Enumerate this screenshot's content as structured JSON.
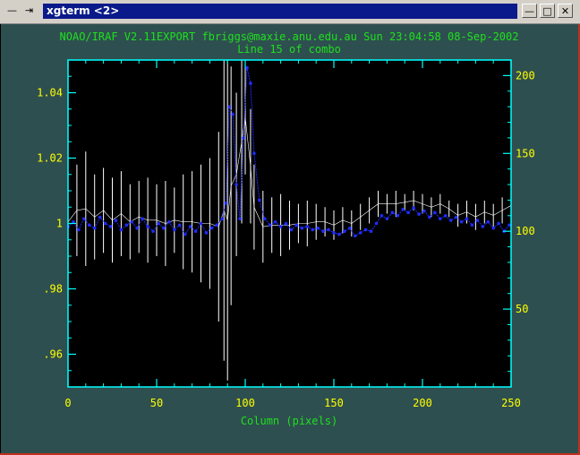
{
  "window": {
    "title": "xgterm <2>",
    "menu_glyph": "—",
    "pin_glyph": "⇥",
    "minimize_glyph": "—",
    "maximize_glyph": "□",
    "close_glyph": "✕"
  },
  "header": {
    "line1": "NOAO/IRAF V2.11EXPORT fbriggs@maxie.anu.edu.au Sun 23:04:58 08-Sep-2002",
    "line2": "Line 15 of combo"
  },
  "chart_data": {
    "type": "line",
    "title": "Line 15 of combo",
    "xlabel": "Column (pixels)",
    "ylabel": "",
    "xlim": [
      0,
      250
    ],
    "ylim": [
      0.95,
      1.05
    ],
    "y2lim": [
      0,
      210
    ],
    "xticks": [
      "0",
      "50",
      "100",
      "150",
      "200",
      "250"
    ],
    "yticks": [
      {
        "value": 0.96,
        "label": ".96"
      },
      {
        "value": 0.98,
        "label": ".98"
      },
      {
        "value": 1.0,
        "label": "1"
      },
      {
        "value": 1.02,
        "label": "1.02"
      },
      {
        "value": 1.04,
        "label": "1.04"
      }
    ],
    "y2ticks": [
      {
        "value": 50,
        "label": "50"
      },
      {
        "value": 100,
        "label": "100"
      },
      {
        "value": 150,
        "label": "150"
      },
      {
        "value": 200,
        "label": "200"
      }
    ],
    "colors": {
      "axes": "#00ffff",
      "ticklabels": "#ffff00",
      "text": "#1ee01e",
      "series_white": "#ffffff",
      "series_blue": "#1e2cff"
    },
    "series": [
      {
        "color": "#ffffff",
        "style": "vertical-lines",
        "x": [
          0,
          5,
          10,
          15,
          20,
          25,
          30,
          35,
          40,
          45,
          50,
          55,
          60,
          65,
          70,
          75,
          80,
          85,
          88,
          90,
          92,
          95,
          98,
          100,
          103,
          105,
          110,
          115,
          120,
          125,
          130,
          135,
          140,
          145,
          150,
          155,
          160,
          165,
          170,
          175,
          180,
          185,
          190,
          195,
          200,
          205,
          210,
          215,
          220,
          225,
          230,
          235,
          240,
          245,
          250
        ],
        "ymin": [
          0.988,
          0.99,
          0.987,
          0.989,
          0.991,
          0.988,
          0.99,
          0.989,
          0.991,
          0.988,
          0.99,
          0.987,
          0.991,
          0.986,
          0.985,
          0.982,
          0.98,
          0.97,
          0.958,
          0.952,
          0.975,
          0.99,
          1.0,
          1.015,
          1.0,
          0.992,
          0.988,
          0.991,
          0.99,
          0.992,
          0.994,
          0.993,
          0.995,
          0.996,
          0.995,
          0.997,
          0.996,
          0.998,
          1.0,
          1.002,
          1.003,
          1.002,
          1.004,
          1.004,
          1.003,
          1.002,
          1.003,
          1.002,
          0.999,
          1.0,
          0.998,
          1.0,
          0.999,
          1.0,
          1.001
        ],
        "ymax": [
          1.013,
          1.018,
          1.022,
          1.015,
          1.017,
          1.014,
          1.016,
          1.012,
          1.013,
          1.014,
          1.012,
          1.013,
          1.011,
          1.015,
          1.016,
          1.018,
          1.02,
          1.028,
          1.05,
          1.05,
          1.048,
          1.04,
          1.05,
          1.05,
          1.035,
          1.018,
          1.01,
          1.008,
          1.009,
          1.007,
          1.006,
          1.007,
          1.006,
          1.005,
          1.004,
          1.005,
          1.004,
          1.006,
          1.008,
          1.01,
          1.009,
          1.01,
          1.009,
          1.01,
          1.009,
          1.008,
          1.009,
          1.007,
          1.006,
          1.007,
          1.006,
          1.007,
          1.006,
          1.008,
          1.01
        ]
      },
      {
        "color": "#1e2cff",
        "style": "points",
        "x": [
          0,
          3,
          6,
          9,
          12,
          15,
          18,
          21,
          24,
          27,
          30,
          33,
          36,
          39,
          42,
          45,
          48,
          51,
          54,
          57,
          60,
          63,
          66,
          69,
          72,
          75,
          78,
          81,
          84,
          87,
          89,
          91,
          93,
          95,
          97,
          99,
          101,
          103,
          105,
          108,
          111,
          114,
          117,
          120,
          123,
          126,
          129,
          132,
          135,
          138,
          141,
          144,
          147,
          150,
          153,
          156,
          159,
          162,
          165,
          168,
          171,
          174,
          177,
          180,
          183,
          186,
          189,
          192,
          195,
          198,
          201,
          204,
          207,
          210,
          213,
          216,
          219,
          222,
          225,
          228,
          231,
          234,
          237,
          240,
          243,
          246,
          249
        ],
        "y": [
          103,
          106,
          101,
          108,
          104,
          102,
          109,
          105,
          103,
          107,
          101,
          104,
          106,
          102,
          108,
          103,
          100,
          105,
          102,
          106,
          101,
          104,
          98,
          103,
          100,
          105,
          99,
          102,
          104,
          108,
          118,
          180,
          175,
          130,
          108,
          160,
          205,
          195,
          150,
          120,
          108,
          104,
          106,
          103,
          105,
          101,
          104,
          102,
          103,
          101,
          102,
          100,
          101,
          99,
          98,
          100,
          102,
          97,
          99,
          101,
          100,
          105,
          110,
          108,
          112,
          110,
          114,
          112,
          115,
          111,
          113,
          109,
          112,
          108,
          110,
          107,
          109,
          106,
          108,
          104,
          107,
          103,
          106,
          102,
          105,
          100,
          104
        ]
      }
    ]
  }
}
